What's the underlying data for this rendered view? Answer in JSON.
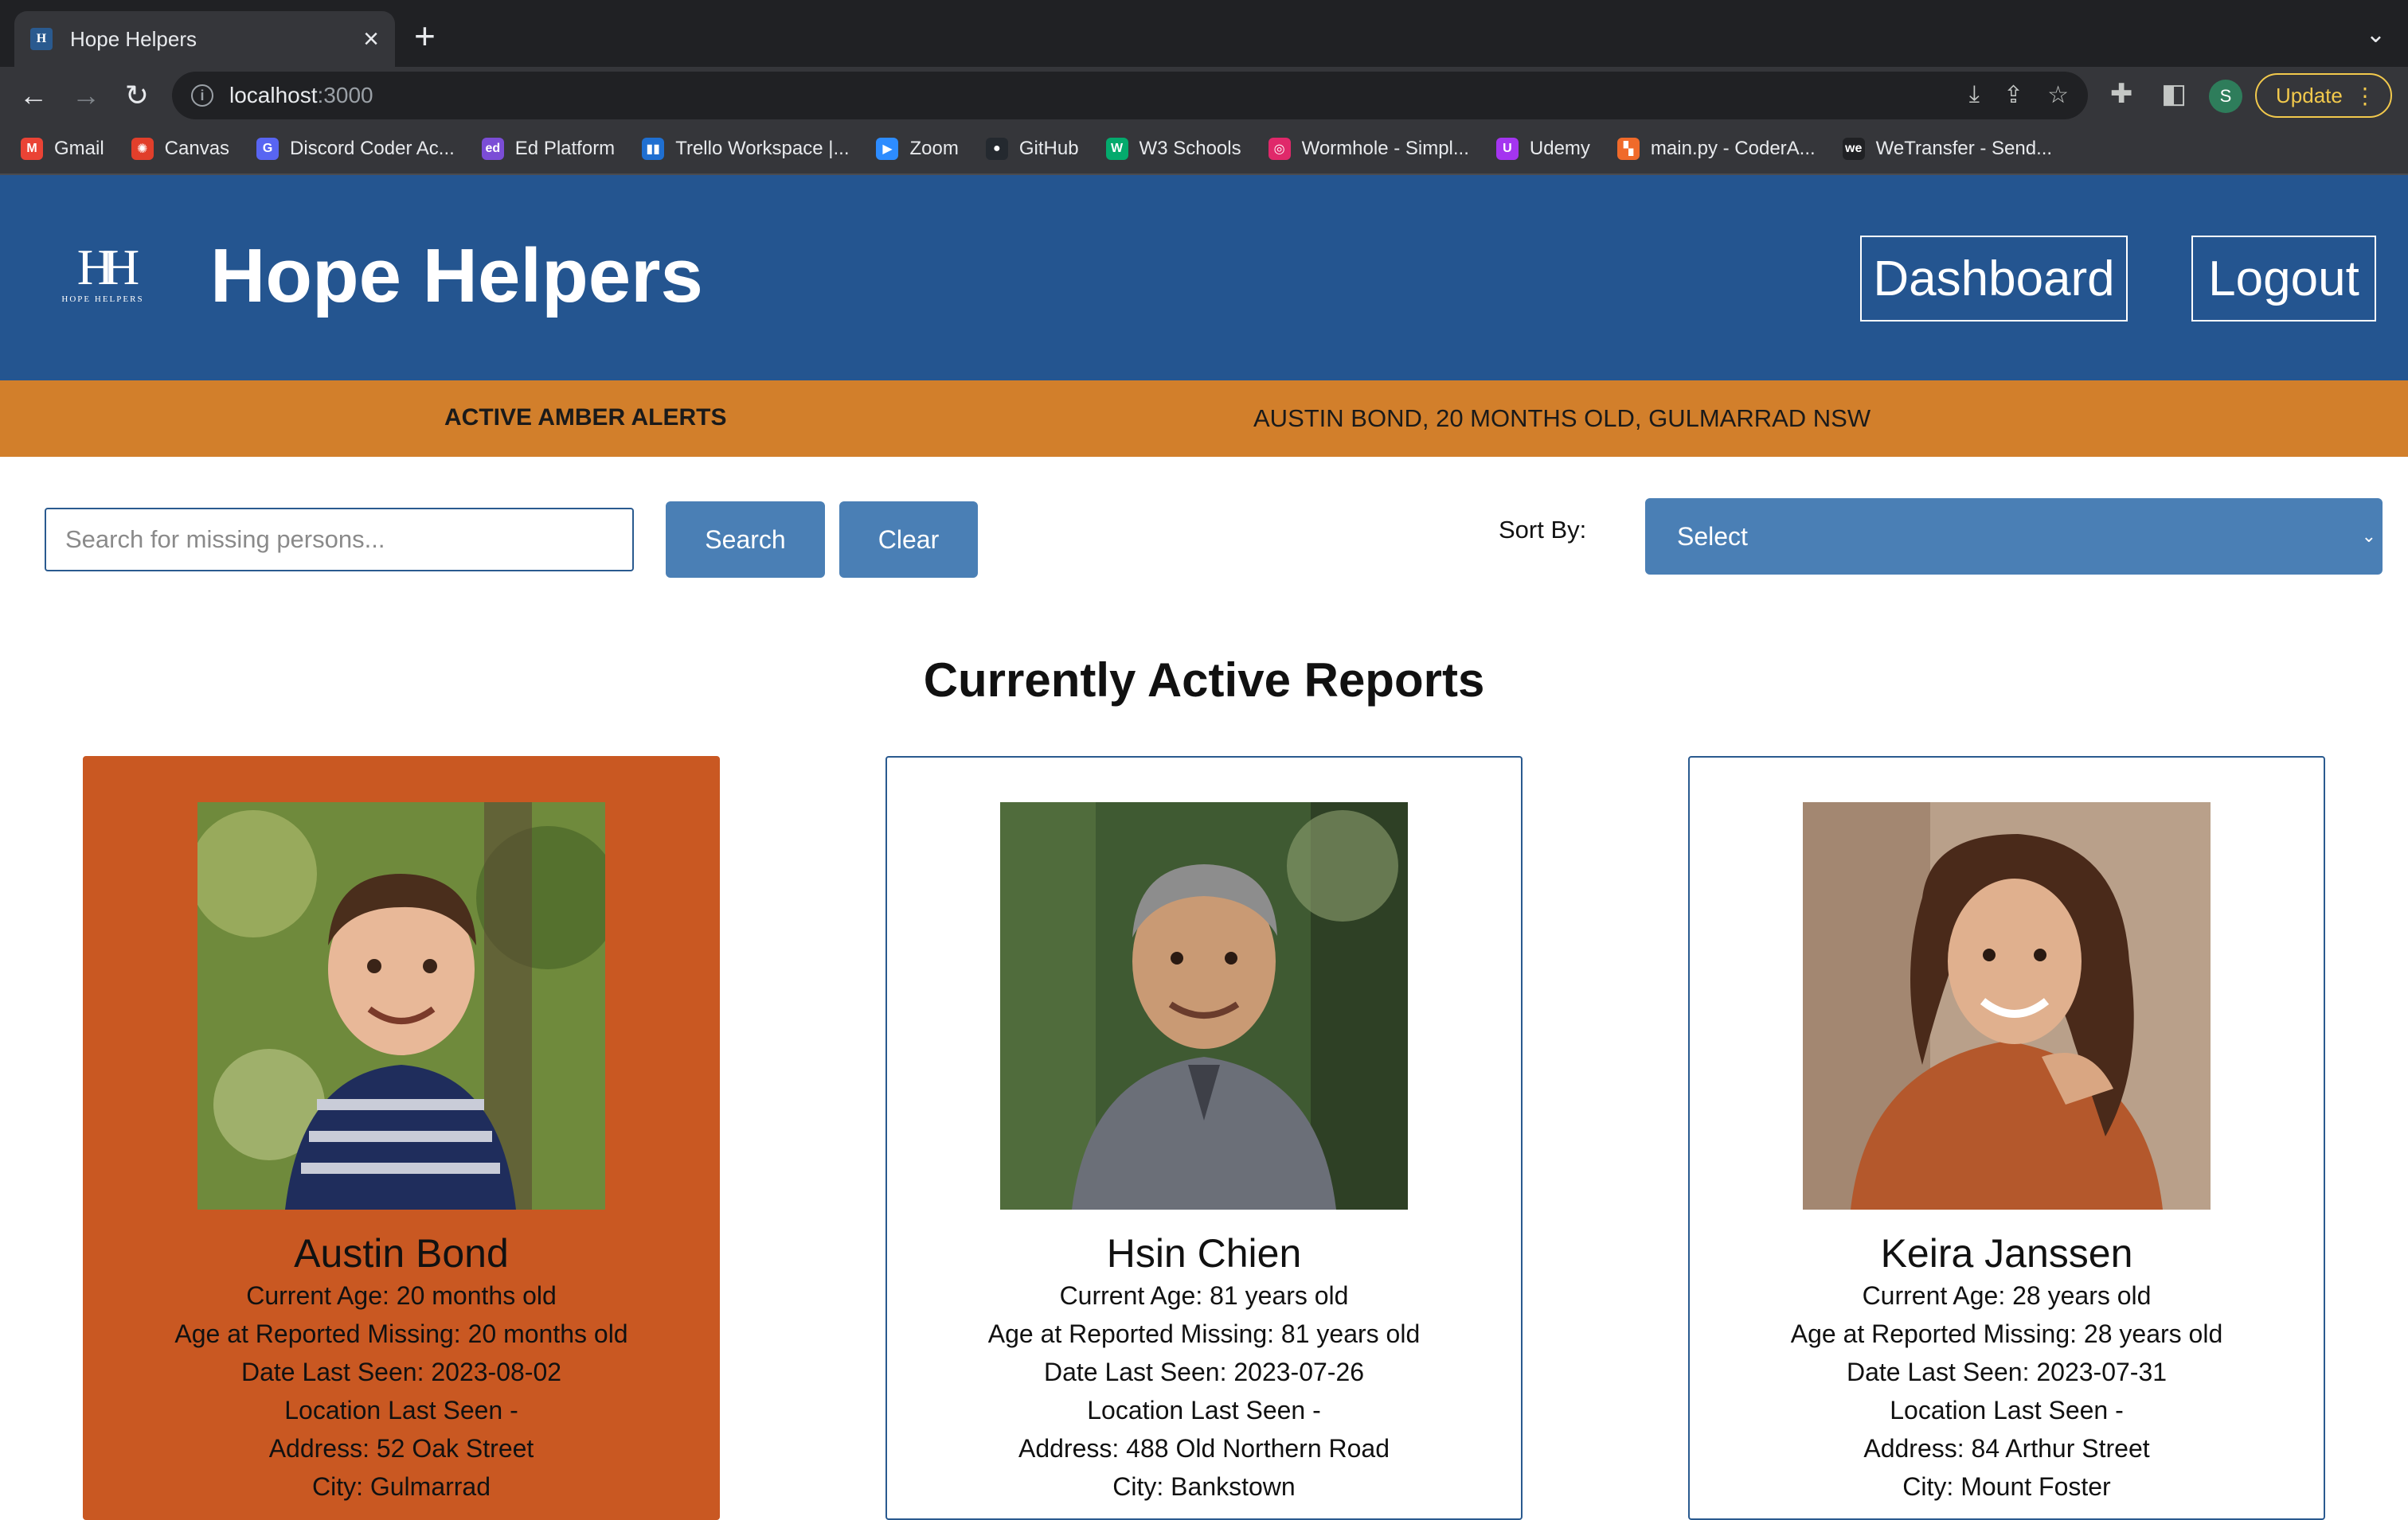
{
  "browser": {
    "tab_title": "Hope Helpers",
    "url_host": "localhost",
    "url_port": ":3000",
    "profile_initial": "S",
    "update_label": "Update",
    "bookmarks": [
      {
        "label": "Gmail",
        "color": "#ea4335",
        "glyph": "M"
      },
      {
        "label": "Canvas",
        "color": "#e13f2b",
        "glyph": "✺"
      },
      {
        "label": "Discord Coder Ac...",
        "color": "#5865f2",
        "glyph": "G"
      },
      {
        "label": "Ed Platform",
        "color": "#7b4dd6",
        "glyph": "ed"
      },
      {
        "label": "Trello Workspace |...",
        "color": "#1f6fd1",
        "glyph": "▮▮"
      },
      {
        "label": "Zoom",
        "color": "#2d8cff",
        "glyph": "▶"
      },
      {
        "label": "GitHub",
        "color": "#24292f",
        "glyph": "●"
      },
      {
        "label": "W3 Schools",
        "color": "#04aa6d",
        "glyph": "W"
      },
      {
        "label": "Wormhole - Simpl...",
        "color": "#e0286a",
        "glyph": "◎"
      },
      {
        "label": "Udemy",
        "color": "#a435f0",
        "glyph": "U"
      },
      {
        "label": "main.py - CoderA...",
        "color": "#f06a2a",
        "glyph": "▚"
      },
      {
        "label": "WeTransfer - Send...",
        "color": "#202124",
        "glyph": "we"
      }
    ]
  },
  "header": {
    "logo_mark": "HH",
    "logo_text": "HOPE HELPERS",
    "title": "Hope Helpers",
    "dashboard_label": "Dashboard",
    "logout_label": "Logout",
    "bg_color": "#245590"
  },
  "amber": {
    "label": "ACTIVE AMBER ALERTS",
    "message": "AUSTIN BOND, 20 MONTHS OLD, GULMARRAD NSW",
    "bg_color": "#d27f2b"
  },
  "search": {
    "placeholder": "Search for missing persons...",
    "search_label": "Search",
    "clear_label": "Clear",
    "sort_label": "Sort By:",
    "sort_value": "Select"
  },
  "reports": {
    "title": "Currently Active Reports",
    "cards": [
      {
        "name": "Austin Bond",
        "current_age": "Current Age: 20 months old",
        "age_missing": "Age at Reported Missing: 20 months old",
        "date_seen": "Date Last Seen: 2023-08-02",
        "location_label": "Location Last Seen -",
        "address": "Address: 52 Oak Street",
        "city": "City: Gulmarrad",
        "alert": true
      },
      {
        "name": "Hsin Chien",
        "current_age": "Current Age: 81 years old",
        "age_missing": "Age at Reported Missing: 81 years old",
        "date_seen": "Date Last Seen: 2023-07-26",
        "location_label": "Location Last Seen -",
        "address": "Address: 488 Old Northern Road",
        "city": "City: Bankstown",
        "alert": false
      },
      {
        "name": "Keira Janssen",
        "current_age": "Current Age: 28 years old",
        "age_missing": "Age at Reported Missing: 28 years old",
        "date_seen": "Date Last Seen: 2023-07-31",
        "location_label": "Location Last Seen -",
        "address": "Address: 84 Arthur Street",
        "city": "City: Mount Foster",
        "alert": false
      }
    ]
  }
}
